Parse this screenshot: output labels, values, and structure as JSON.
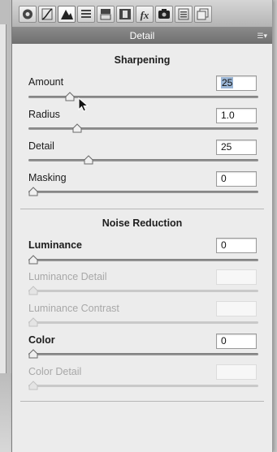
{
  "panel": {
    "title": "Detail"
  },
  "tabs": [
    {
      "name": "basic-tab-icon",
      "glyph": "◉"
    },
    {
      "name": "tone-curve-tab-icon",
      "glyph": "⁄"
    },
    {
      "name": "detail-tab-icon",
      "glyph": "▲"
    },
    {
      "name": "hsl-tab-icon",
      "glyph": "≡"
    },
    {
      "name": "split-toning-tab-icon",
      "glyph": "▤"
    },
    {
      "name": "lens-corrections-tab-icon",
      "glyph": "◧"
    },
    {
      "name": "effects-tab-icon",
      "glyph": "fx"
    },
    {
      "name": "camera-calibration-tab-icon",
      "glyph": "●"
    },
    {
      "name": "presets-tab-icon",
      "glyph": "☷"
    },
    {
      "name": "snapshots-tab-icon",
      "glyph": "❐"
    }
  ],
  "sharpening": {
    "heading": "Sharpening",
    "amount": {
      "label": "Amount",
      "value": "25",
      "level": 0.167
    },
    "radius": {
      "label": "Radius",
      "value": "1.0",
      "level": 0.2
    },
    "detail": {
      "label": "Detail",
      "value": "25",
      "level": 0.25
    },
    "masking": {
      "label": "Masking",
      "value": "0",
      "level": 0
    }
  },
  "noise_reduction": {
    "heading": "Noise Reduction",
    "luminance": {
      "label": "Luminance",
      "value": "0",
      "level": 0
    },
    "luminance_detail": {
      "label": "Luminance Detail",
      "value": "",
      "level": 0
    },
    "luminance_contrast": {
      "label": "Luminance Contrast",
      "value": "",
      "level": 0
    },
    "color": {
      "label": "Color",
      "value": "0",
      "level": 0
    },
    "color_detail": {
      "label": "Color Detail",
      "value": "",
      "level": 0
    }
  }
}
